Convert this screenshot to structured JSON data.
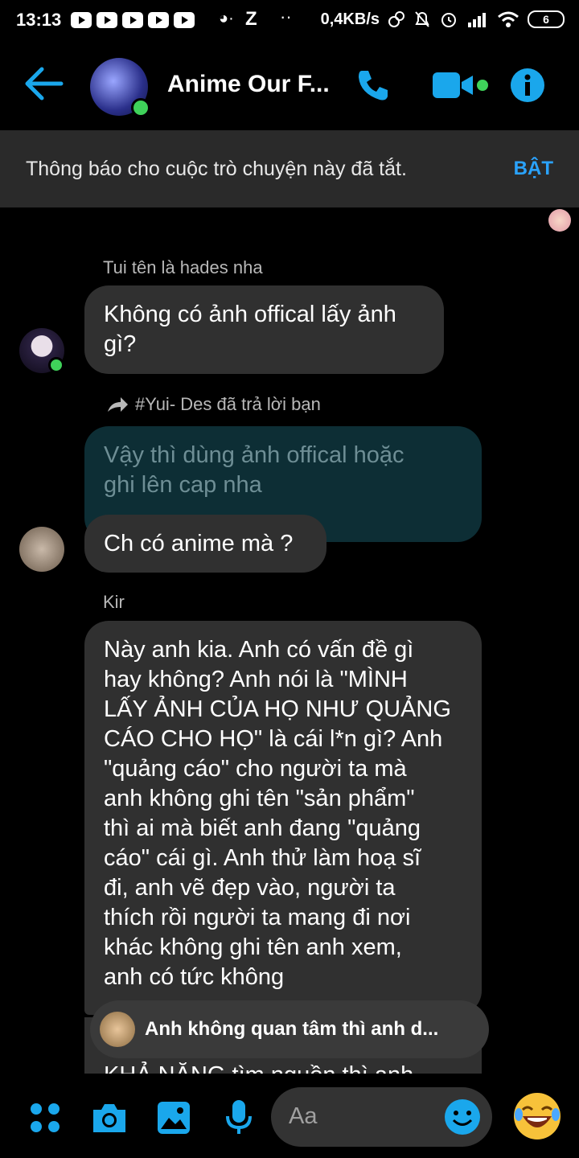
{
  "status_bar": {
    "time": "13:13",
    "net_speed": "0,4KB/s",
    "battery": "6",
    "z_label": "Z"
  },
  "header": {
    "title": "Anime Our F...",
    "accent": "#1aa7ec"
  },
  "banner": {
    "text": "Thông báo cho cuộc trò chuyện này đã tắt.",
    "button": "BẬT"
  },
  "messages": {
    "m1": {
      "sender": "Tui tên là hades nha",
      "lines": [
        "Không có ảnh offical lấy ảnh",
        "gì?"
      ]
    },
    "reply": {
      "label": "#Yui- Des đã trả lời bạn",
      "quoted_lines": [
        "Vậy thì dùng ảnh offical hoặc",
        "ghi lên cap nha"
      ],
      "text": "Ch có anime mà ?"
    },
    "m3": {
      "sender": "Kir",
      "lines": [
        "Này anh kia. Anh có vấn đề gì",
        "hay không? Anh nói là \"MÌNH",
        "LẤY ẢNH CỦA HỌ NHƯ QUẢNG",
        "CÁO CHO HỌ\" là cái l*n gì? Anh",
        "\"quảng cáo\" cho người ta mà",
        "anh không ghi tên \"sản phẩm\"",
        "thì ai mà biết anh đang \"quảng",
        "cáo\" cái gì. Anh thử làm hoạ sĩ",
        "đi, anh vẽ đẹp vào, người ta",
        "thích rồi người ta mang đi nơi",
        "khác không ghi tên anh xem,",
        "anh có tức không"
      ]
    },
    "cut_text": "KHẢ NĂNG tìm nguồn thì anh"
  },
  "preview_pill": {
    "text": "Anh không quan tâm thì anh d..."
  },
  "composer": {
    "placeholder": "Aa"
  }
}
